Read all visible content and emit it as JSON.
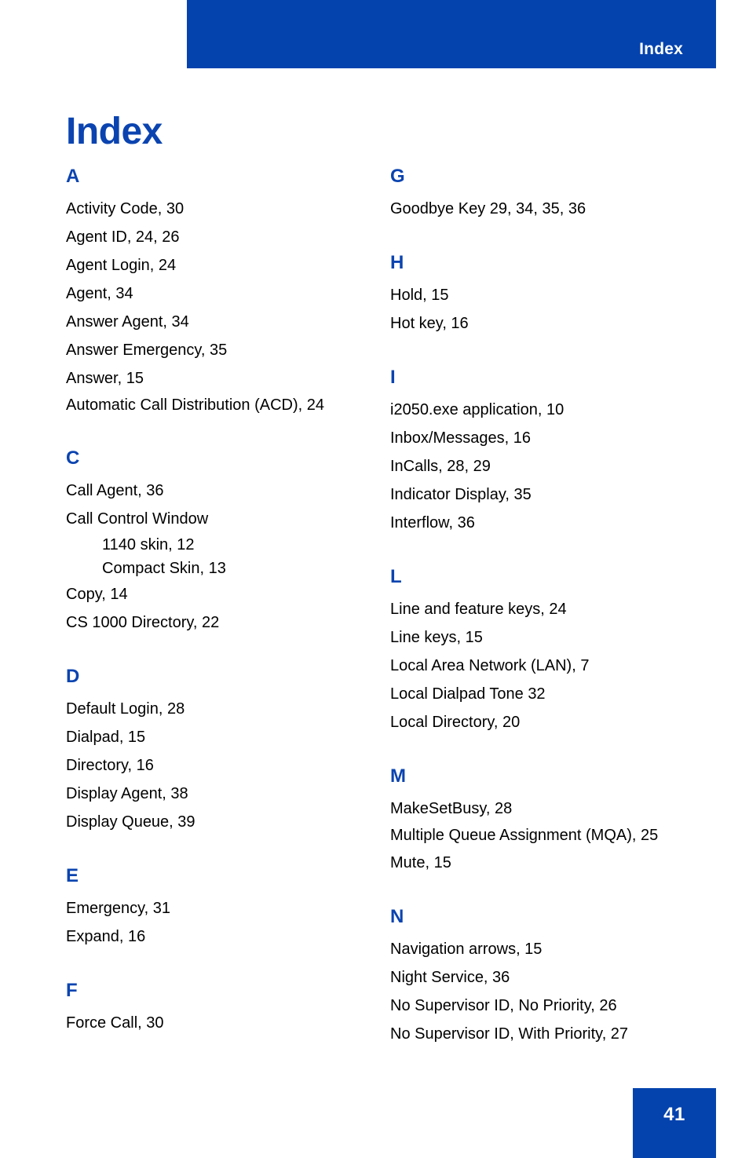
{
  "header": {
    "running_head": "Index"
  },
  "page_title": "Index",
  "footer": {
    "page_number": "41"
  },
  "colors": {
    "brand_blue": "#0443AE",
    "heading_blue": "#0B44B0",
    "text_black": "#000000",
    "page_background": "#FFFFFF"
  },
  "columns": {
    "left": [
      {
        "letter": "A",
        "entries": [
          {
            "text": "Activity Code, 30",
            "level": "main"
          },
          {
            "text": "Agent ID, 24, 26",
            "level": "main"
          },
          {
            "text": "Agent Login, 24",
            "level": "main"
          },
          {
            "text": "Agent, 34",
            "level": "main"
          },
          {
            "text": "Answer Agent, 34",
            "level": "main"
          },
          {
            "text": "Answer Emergency, 35",
            "level": "main"
          },
          {
            "text": "Answer, 15",
            "level": "main"
          },
          {
            "text": "Automatic Call Distribution (ACD), 24",
            "level": "main",
            "wraps": true
          }
        ]
      },
      {
        "letter": "C",
        "entries": [
          {
            "text": "Call Agent, 36",
            "level": "main"
          },
          {
            "text": "Call Control Window",
            "level": "main"
          },
          {
            "text": "1140 skin, 12",
            "level": "sub"
          },
          {
            "text": "Compact Skin, 13",
            "level": "sub"
          },
          {
            "text": "Copy, 14",
            "level": "main"
          },
          {
            "text": "CS 1000 Directory, 22",
            "level": "main"
          }
        ]
      },
      {
        "letter": "D",
        "entries": [
          {
            "text": "Default Login, 28",
            "level": "main"
          },
          {
            "text": "Dialpad, 15",
            "level": "main"
          },
          {
            "text": "Directory, 16",
            "level": "main"
          },
          {
            "text": "Display Agent, 38",
            "level": "main"
          },
          {
            "text": "Display Queue, 39",
            "level": "main"
          }
        ]
      },
      {
        "letter": "E",
        "entries": [
          {
            "text": "Emergency, 31",
            "level": "main"
          },
          {
            "text": "Expand, 16",
            "level": "main"
          }
        ]
      },
      {
        "letter": "F",
        "entries": [
          {
            "text": "Force Call, 30",
            "level": "main"
          }
        ]
      }
    ],
    "right": [
      {
        "letter": "G",
        "entries": [
          {
            "text": "Goodbye Key 29, 34, 35, 36",
            "level": "main"
          }
        ]
      },
      {
        "letter": "H",
        "entries": [
          {
            "text": "Hold, 15",
            "level": "main"
          },
          {
            "text": "Hot key, 16",
            "level": "main"
          }
        ]
      },
      {
        "letter": "I",
        "entries": [
          {
            "text": "i2050.exe application, 10",
            "level": "main"
          },
          {
            "text": "Inbox/Messages, 16",
            "level": "main"
          },
          {
            "text": "InCalls, 28, 29",
            "level": "main"
          },
          {
            "text": "Indicator Display, 35",
            "level": "main"
          },
          {
            "text": "Interflow, 36",
            "level": "main"
          }
        ]
      },
      {
        "letter": "L",
        "entries": [
          {
            "text": "Line and feature keys, 24",
            "level": "main"
          },
          {
            "text": "Line keys, 15",
            "level": "main"
          },
          {
            "text": "Local Area Network (LAN), 7",
            "level": "main"
          },
          {
            "text": "Local Dialpad Tone 32",
            "level": "main"
          },
          {
            "text": "Local Directory, 20",
            "level": "main"
          }
        ]
      },
      {
        "letter": "M",
        "entries": [
          {
            "text": "MakeSetBusy, 28",
            "level": "main"
          },
          {
            "text": "Multiple Queue Assignment (MQA), 25",
            "level": "main",
            "wraps": true
          },
          {
            "text": "Mute, 15",
            "level": "main"
          }
        ]
      },
      {
        "letter": "N",
        "entries": [
          {
            "text": "Navigation arrows, 15",
            "level": "main"
          },
          {
            "text": "Night Service, 36",
            "level": "main"
          },
          {
            "text": "No Supervisor ID, No Priority, 26",
            "level": "main"
          },
          {
            "text": "No Supervisor ID, With Priority, 27",
            "level": "main"
          }
        ]
      }
    ]
  }
}
